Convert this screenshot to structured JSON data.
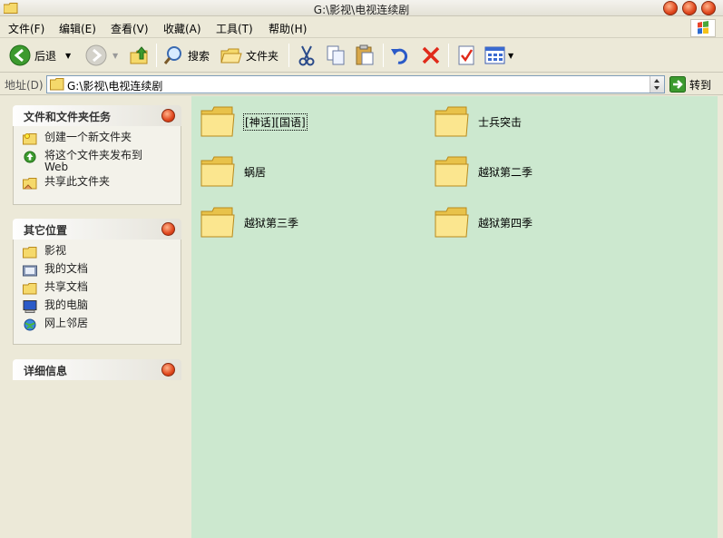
{
  "window": {
    "title": "G:\\影视\\电视连续剧"
  },
  "menu": [
    "文件(F)",
    "编辑(E)",
    "查看(V)",
    "收藏(A)",
    "工具(T)",
    "帮助(H)"
  ],
  "toolbar": {
    "back_label": "后退",
    "search_label": "搜索",
    "folders_label": "文件夹"
  },
  "address": {
    "label": "地址(D)",
    "value": "G:\\影视\\电视连续剧",
    "go_label": "转到"
  },
  "tasks_panel": {
    "title": "文件和文件夹任务",
    "items": [
      "创建一个新文件夹",
      "将这个文件夹发布到",
      "Web",
      "共享此文件夹"
    ]
  },
  "places_panel": {
    "title": "其它位置",
    "items": [
      "影视",
      "我的文档",
      "共享文档",
      "我的电脑",
      "网上邻居"
    ]
  },
  "details_panel": {
    "title": "详细信息"
  },
  "folders": [
    "[神话][国语]",
    "士兵突击",
    "蜗居",
    "越狱第二季",
    "越狱第三季",
    "越狱第四季"
  ],
  "colors": {
    "content_bg": "#cce8cf",
    "chrome_bg": "#ece9d8",
    "folder_yellow": "#f5d96b"
  }
}
